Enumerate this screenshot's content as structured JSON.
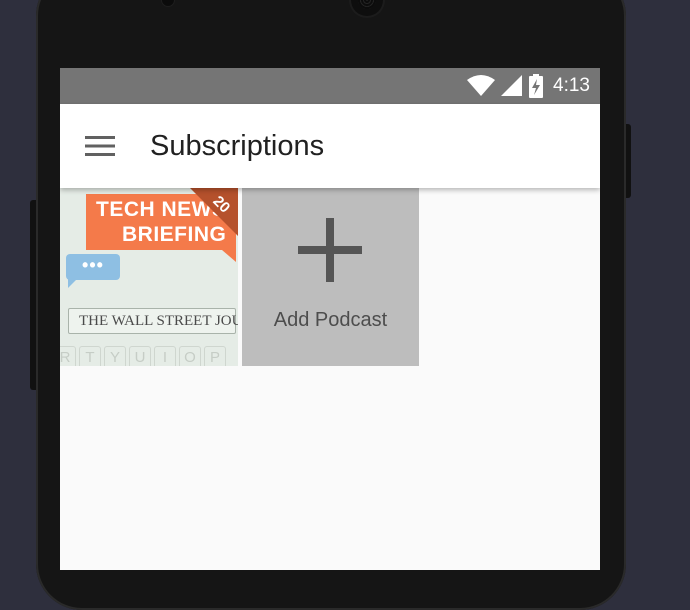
{
  "status_bar": {
    "time": "4:13",
    "icons": [
      "wifi-icon",
      "signal-icon",
      "battery-charging-icon"
    ],
    "color": "#757575"
  },
  "app_bar": {
    "menu_icon": "hamburger-menu-icon",
    "title": "Subscriptions"
  },
  "subscriptions": [
    {
      "podcast": "Tech News Briefing",
      "artwork": {
        "line1": "TECH NEWS",
        "line2": "BRIEFING",
        "bubble": "•••",
        "publisher": "THE WALL STREET JOURNAL.",
        "keys": [
          "R",
          "T",
          "Y",
          "U",
          "I",
          "O",
          "P"
        ]
      },
      "badge": "20"
    }
  ],
  "add_tile": {
    "label": "Add Podcast",
    "icon": "plus-icon"
  },
  "colors": {
    "accent": "#f47a4a",
    "badge": "#b5512c",
    "add_tile_bg": "#bdbdbd",
    "screen_bg": "#fafafa"
  }
}
